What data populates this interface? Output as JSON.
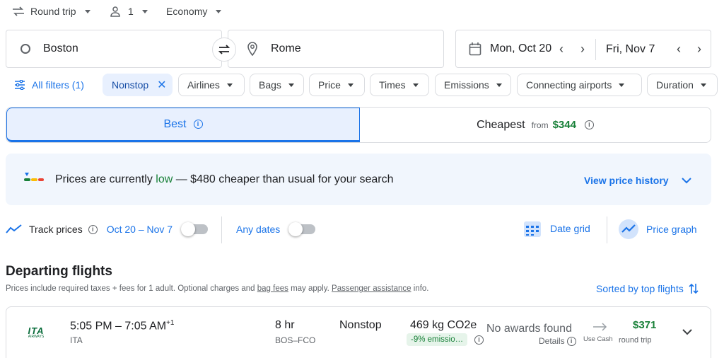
{
  "search": {
    "trip_type": "Round trip",
    "passengers": "1",
    "cabin": "Economy",
    "origin": "Boston",
    "destination": "Rome",
    "depart_date": "Mon, Oct 20",
    "return_date": "Fri, Nov 7"
  },
  "filters": {
    "all_filters": "All filters (1)",
    "nonstop": "Nonstop",
    "airlines": "Airlines",
    "bags": "Bags",
    "price": "Price",
    "times": "Times",
    "emissions": "Emissions",
    "connecting_airports": "Connecting airports",
    "duration": "Duration"
  },
  "sort_tabs": {
    "best": "Best",
    "cheapest": "Cheapest",
    "cheapest_from": "from",
    "cheapest_price": "$344"
  },
  "price_insight": {
    "prefix": "Prices are currently ",
    "level": "low",
    "suffix": " — $480 cheaper than usual for your search",
    "history_link": "View price history"
  },
  "tracking": {
    "track_label": "Track prices",
    "date_range": "Oct 20 – Nov 7",
    "any_dates": "Any dates",
    "date_grid": "Date grid",
    "price_graph": "Price graph"
  },
  "results": {
    "heading": "Departing flights",
    "note_prefix": "Prices include required taxes + fees for 1 adult. Optional charges and ",
    "bag_fees": "bag fees",
    "note_mid": " may apply. ",
    "passenger_assistance": "Passenger assistance",
    "note_suffix": " info.",
    "sorted_by": "Sorted by top flights"
  },
  "flights": [
    {
      "times": "5:05 PM – 7:05 AM",
      "plus_days": "+1",
      "airline": "ITA",
      "logo_text": "ITA",
      "logo_sub": "AIRWAYS",
      "duration": "8 hr",
      "route": "BOS–FCO",
      "stops": "Nonstop",
      "co2": "469 kg CO2e",
      "emissions_badge": "-9% emissio…",
      "awards": "No awards found",
      "details": "Details",
      "use_cash": "Use Cash",
      "price": "$371",
      "price_type": "round trip"
    }
  ],
  "colors": {
    "accent_blue": "#1a73e8",
    "price_green": "#188038",
    "selected_tab_bg": "#e8f0fe",
    "insight_bg": "#f1f6fd"
  }
}
